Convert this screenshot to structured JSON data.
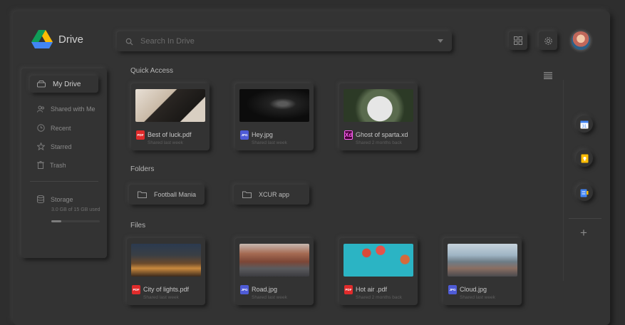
{
  "app": {
    "title": "Drive"
  },
  "search": {
    "placeholder": "Search In Drive"
  },
  "sidebar": {
    "active_label": "My Drive",
    "items": [
      {
        "label": "Shared with Me",
        "icon": "people-icon"
      },
      {
        "label": "Recent",
        "icon": "clock-icon"
      },
      {
        "label": "Starred",
        "icon": "star-icon"
      },
      {
        "label": "Trash",
        "icon": "trash-icon"
      }
    ],
    "storage": {
      "label": "Storage",
      "used": "3.0 GB of 15 GB used",
      "fraction": 0.2
    }
  },
  "quick_access": {
    "title": "Quick Access",
    "items": [
      {
        "name": "Best of luck.pdf",
        "sub": "Shared last week",
        "type": "PDF",
        "type_color": "#e02b2b"
      },
      {
        "name": "Hey.jpg",
        "sub": "Shared last week",
        "type": "JPG",
        "type_color": "#4e5bd6"
      },
      {
        "name": "Ghost of  sparta.xd",
        "sub": "Shared 2 months back",
        "type": "Xd",
        "type_color": "#470137"
      }
    ]
  },
  "folders": {
    "title": "Folders",
    "items": [
      {
        "name": "Football Mania"
      },
      {
        "name": "XCUR app"
      }
    ]
  },
  "files": {
    "title": "Files",
    "items": [
      {
        "name": "City of lights.pdf",
        "sub": "Shared last week",
        "type": "PDF",
        "type_color": "#e02b2b"
      },
      {
        "name": "Road.jpg",
        "sub": "Shared last week",
        "type": "JPG",
        "type_color": "#4e5bd6"
      },
      {
        "name": "Hot air .pdf",
        "sub": "Shared 2 months back",
        "type": "PDF",
        "type_color": "#e02b2b"
      },
      {
        "name": "Cloud.jpg",
        "sub": "Shared last week",
        "type": "JPG",
        "type_color": "#4e5bd6"
      }
    ]
  },
  "right_rail": {
    "apps": [
      "calendar-icon",
      "keep-icon",
      "tasks-icon"
    ]
  }
}
